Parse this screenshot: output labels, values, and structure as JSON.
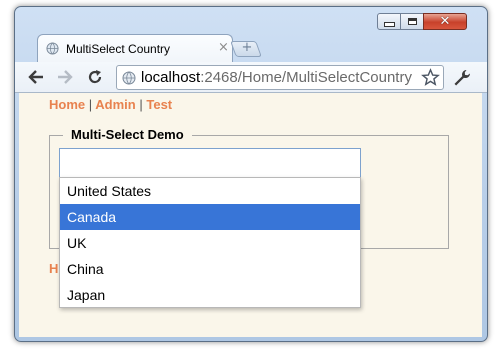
{
  "browser": {
    "tab_title": "MultiSelect Country",
    "tab_close": "×",
    "new_tab": "+",
    "url_host": "localhost",
    "url_path": ":2468/Home/MultiSelectCountry"
  },
  "page": {
    "nav": [
      {
        "label": "Home"
      },
      {
        "label": "Admin"
      },
      {
        "label": "Test"
      }
    ],
    "nav_separator": "|",
    "fieldset_legend": "Multi-Select Demo",
    "select_value": "",
    "options": [
      {
        "label": "United States",
        "selected": false
      },
      {
        "label": "Canada",
        "selected": true
      },
      {
        "label": "UK",
        "selected": false
      },
      {
        "label": "China",
        "selected": false
      },
      {
        "label": "Japan",
        "selected": false
      }
    ],
    "bottom_link_partial": "H"
  },
  "colors": {
    "link": "#e8824f",
    "highlight": "#3875d7",
    "content_bg": "#faf6ea"
  }
}
